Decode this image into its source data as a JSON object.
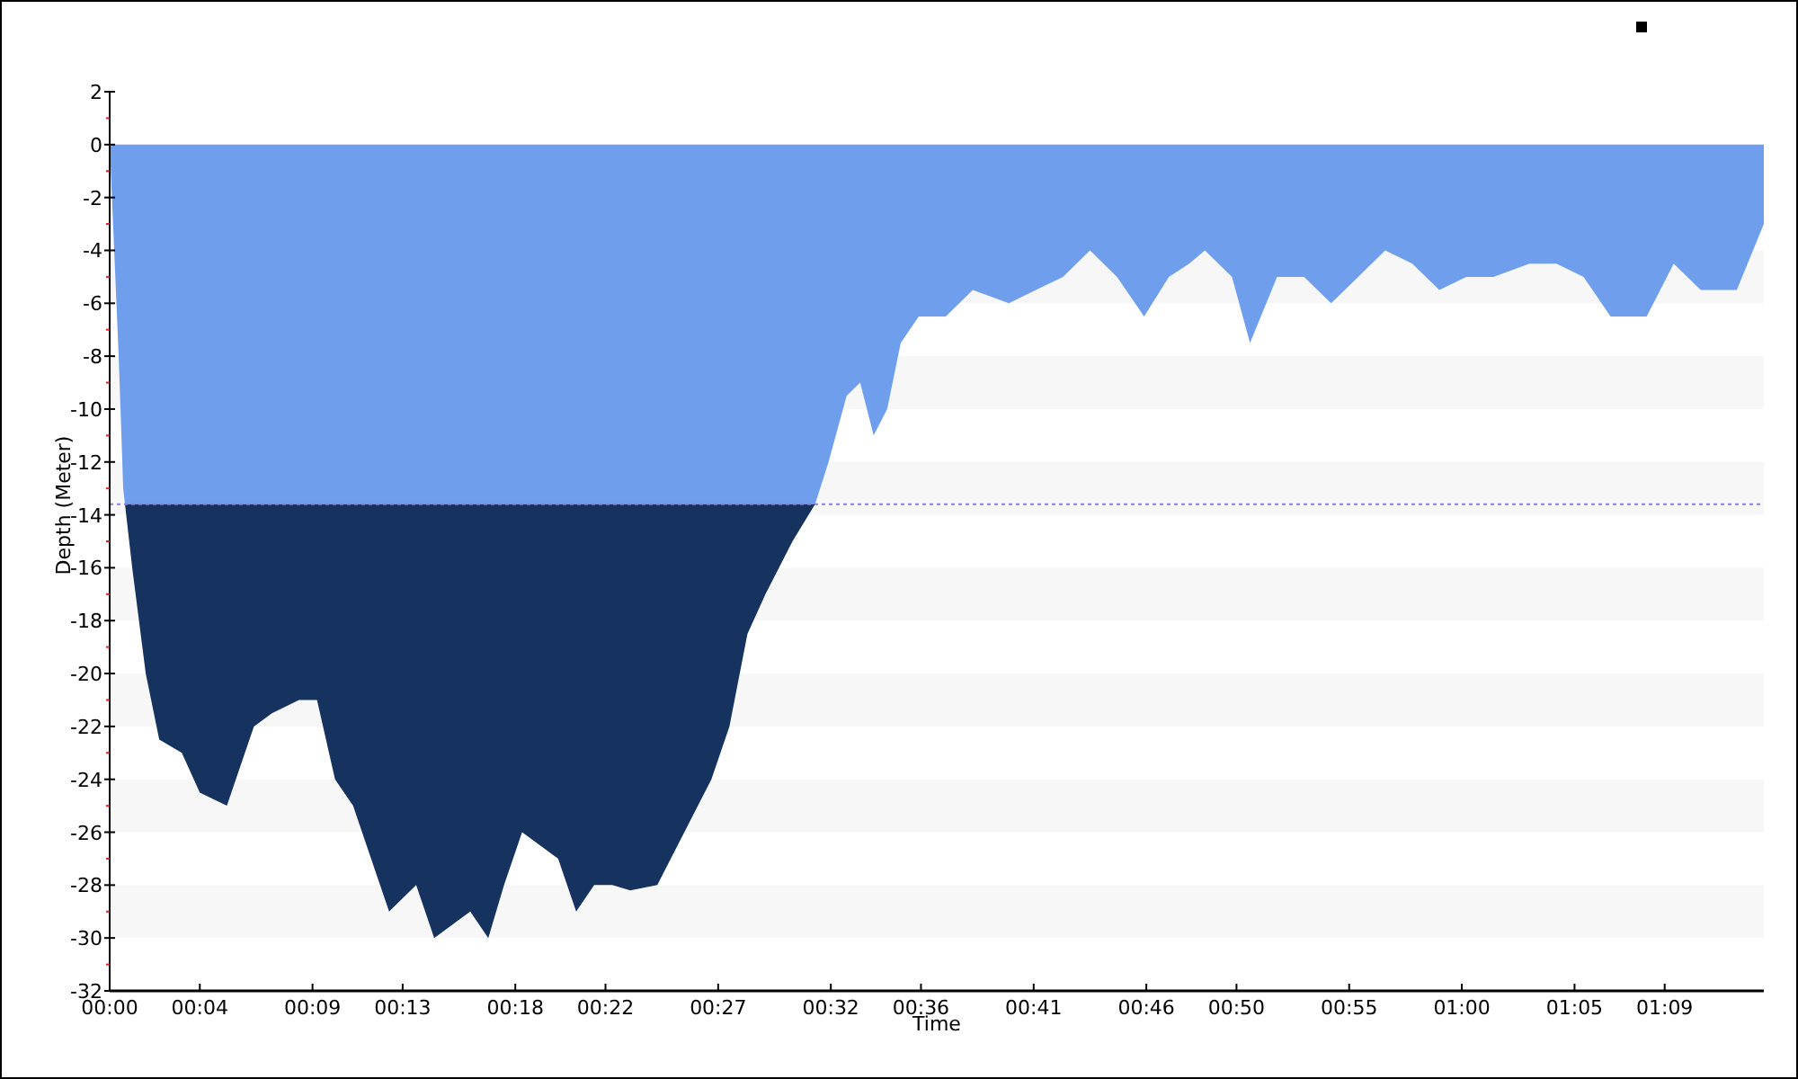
{
  "chart_data": {
    "type": "area",
    "xlabel": "Time",
    "ylabel": "Depth (Meter)",
    "xlim": [
      0,
      73.4
    ],
    "ylim": [
      -32,
      2
    ],
    "xticks": [
      {
        "value": 0,
        "label": "00:00"
      },
      {
        "value": 4,
        "label": "00:04"
      },
      {
        "value": 9,
        "label": "00:09"
      },
      {
        "value": 13,
        "label": "00:13"
      },
      {
        "value": 18,
        "label": "00:18"
      },
      {
        "value": 22,
        "label": "00:22"
      },
      {
        "value": 27,
        "label": "00:27"
      },
      {
        "value": 32,
        "label": "00:32"
      },
      {
        "value": 36,
        "label": "00:36"
      },
      {
        "value": 41,
        "label": "00:41"
      },
      {
        "value": 46,
        "label": "00:46"
      },
      {
        "value": 50,
        "label": "00:50"
      },
      {
        "value": 55,
        "label": "00:55"
      },
      {
        "value": 60,
        "label": "01:00"
      },
      {
        "value": 65,
        "label": "01:05"
      },
      {
        "value": 69,
        "label": "01:09"
      }
    ],
    "yticks": [
      2,
      0,
      -2,
      -4,
      -6,
      -8,
      -10,
      -12,
      -14,
      -16,
      -18,
      -20,
      -22,
      -24,
      -26,
      -28,
      -30,
      -32
    ],
    "x": [
      0,
      0.2,
      0.4,
      0.6,
      1,
      1.6,
      2.2,
      3.2,
      4,
      5.2,
      6.4,
      7.2,
      8.4,
      9.2,
      10,
      10.8,
      11.6,
      12.4,
      13.6,
      14.4,
      15.2,
      16,
      16.8,
      17.5,
      18.3,
      19.1,
      19.9,
      20.7,
      21.5,
      22.3,
      23.1,
      24.3,
      25.5,
      26.7,
      27.5,
      28.3,
      29.1,
      30.3,
      31.3,
      31.9,
      32.7,
      33.3,
      33.9,
      34.5,
      35.1,
      35.9,
      37.1,
      38.3,
      39.9,
      41.1,
      42.3,
      43.5,
      44.7,
      45.9,
      47,
      47.9,
      48.6,
      49.8,
      50.6,
      51.8,
      53,
      54.2,
      55.4,
      56.6,
      57.8,
      59,
      60.2,
      61.4,
      63,
      64.2,
      65.4,
      66.6,
      68.2,
      69.4,
      70.6,
      72.2,
      73.4
    ],
    "series": [
      {
        "color": "#6f9fec",
        "values": [
          0,
          -4,
          -8,
          -13,
          -16,
          -20,
          -22.5,
          -23,
          -24.5,
          -25,
          -22,
          -21.5,
          -21,
          -21,
          -24,
          -25,
          -27,
          -29,
          -28,
          -30,
          -29.5,
          -29,
          -30,
          -28,
          -26,
          -26.5,
          -27,
          -29,
          -28,
          -28,
          -28.2,
          -28,
          -26,
          -24,
          -22,
          -18.5,
          -17,
          -15,
          -13.6,
          -12,
          -9.5,
          -9,
          -11,
          -10,
          -7.5,
          -6.5,
          -6.5,
          -5.5,
          -6,
          -5.5,
          -5,
          -4,
          -5,
          -6.5,
          -5,
          -4.5,
          -4,
          -5,
          -7.5,
          -5,
          -5,
          -6,
          -5,
          -4,
          -4.5,
          -5.5,
          -5,
          -5,
          -4.5,
          -4.5,
          -5,
          -6.5,
          -6.5,
          -4.5,
          -5.5,
          -5.5,
          -3
        ]
      }
    ],
    "ref_lines": [
      {
        "axis": "y",
        "value": -13.6,
        "color": "#8a7fe0"
      }
    ]
  }
}
